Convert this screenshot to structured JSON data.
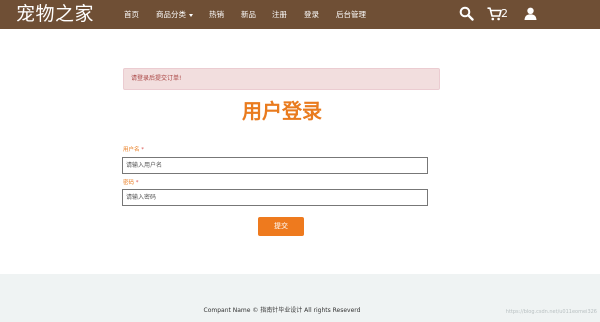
{
  "brand": "宠物之家",
  "nav": {
    "items": [
      "首页",
      "商品分类",
      "热销",
      "新品",
      "注册",
      "登录",
      "后台管理"
    ],
    "cart_count": "2"
  },
  "alert": "请登录后提交订单!",
  "title": "用户登录",
  "form": {
    "username_label": "用户名",
    "username_placeholder": "请输入用户名",
    "password_label": "密码",
    "password_placeholder": "请输入密码",
    "required_mark": "*",
    "submit": "提交"
  },
  "footer": {
    "text": "Compant Name © 指南针毕业设计 All rights Reseverd",
    "watermark": "https://blog.csdn.net/u011eomei326"
  },
  "colors": {
    "navbar": "#6f4f35",
    "accent": "#e97b1e",
    "alert_bg": "#f2dede",
    "footer_bg": "#eff3f3"
  }
}
